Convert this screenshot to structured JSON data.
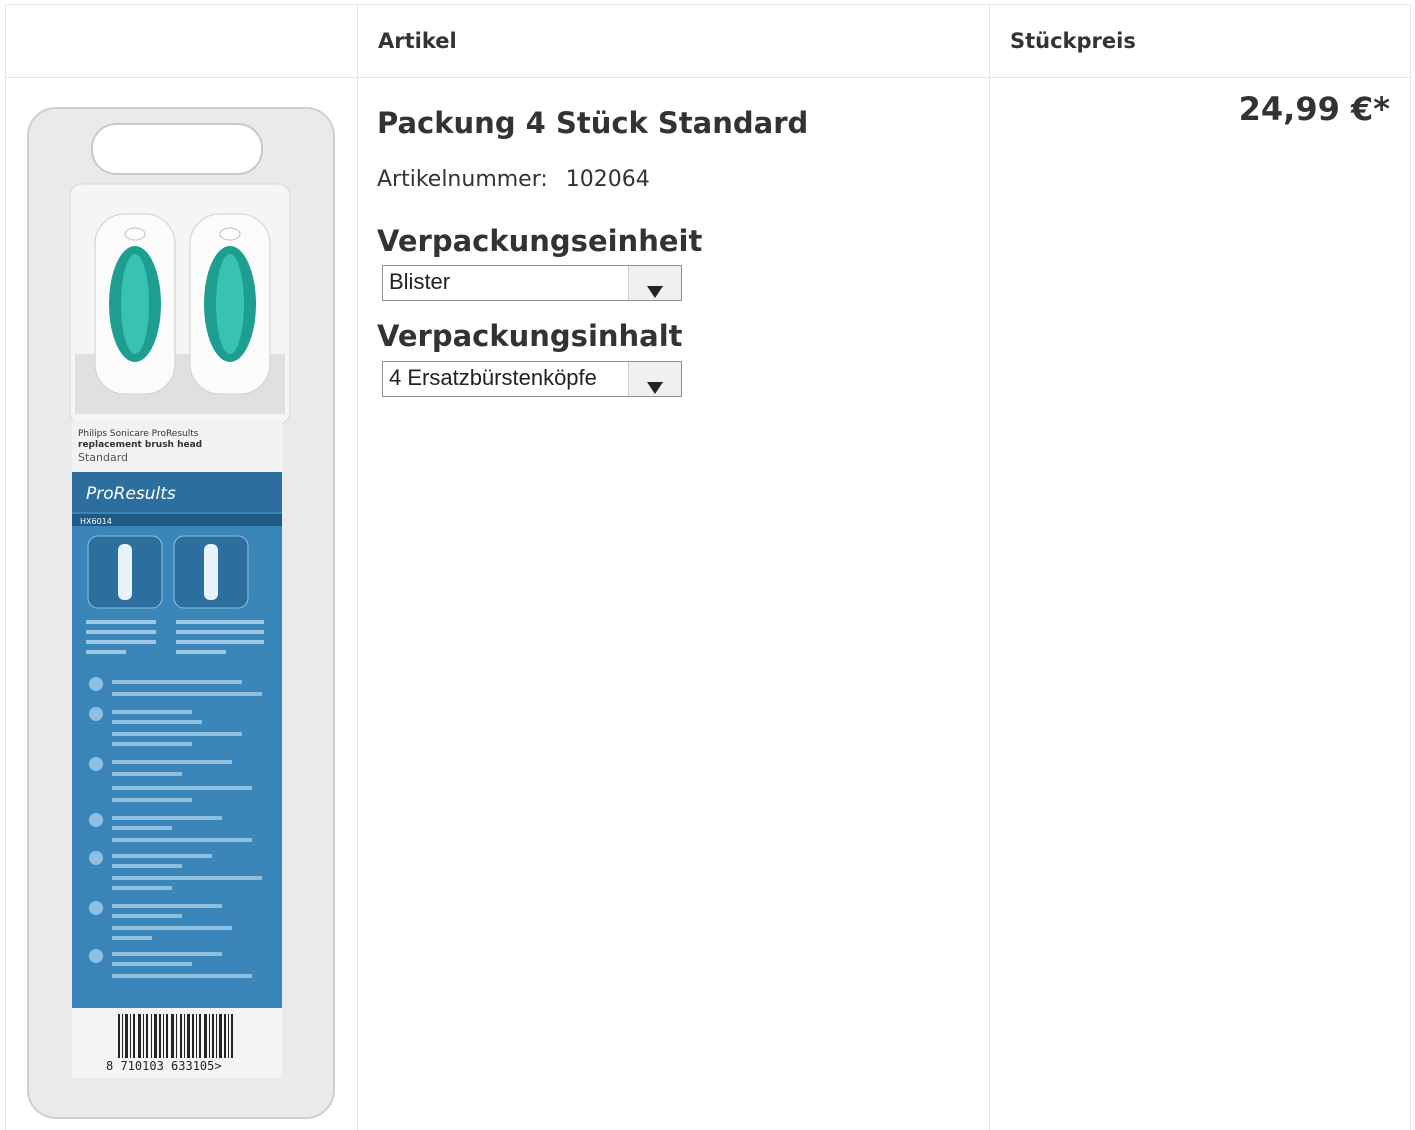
{
  "table": {
    "headers": [
      "",
      "Artikel",
      "Stückpreis"
    ]
  },
  "product": {
    "title": "Packung 4 Stück Standard",
    "article_number_label": "Artikelnummer:",
    "article_number": "102064",
    "price": "24,99 €*",
    "image": {
      "package_line1": "Philips Sonicare ProResults",
      "package_line2": "replacement brush head",
      "package_line3": "Standard",
      "brand": "ProResults",
      "model": "HX6014",
      "barcode": "8 710103 633105>"
    }
  },
  "options": [
    {
      "label": "Verpackungseinheit",
      "selected": "Blister"
    },
    {
      "label": "Verpackungsinhalt",
      "selected": "4 Ersatzbürstenköpfe"
    }
  ],
  "colors": {
    "border": "#e6e6e6",
    "text": "#333333",
    "package_blue": "#3a86b8"
  }
}
